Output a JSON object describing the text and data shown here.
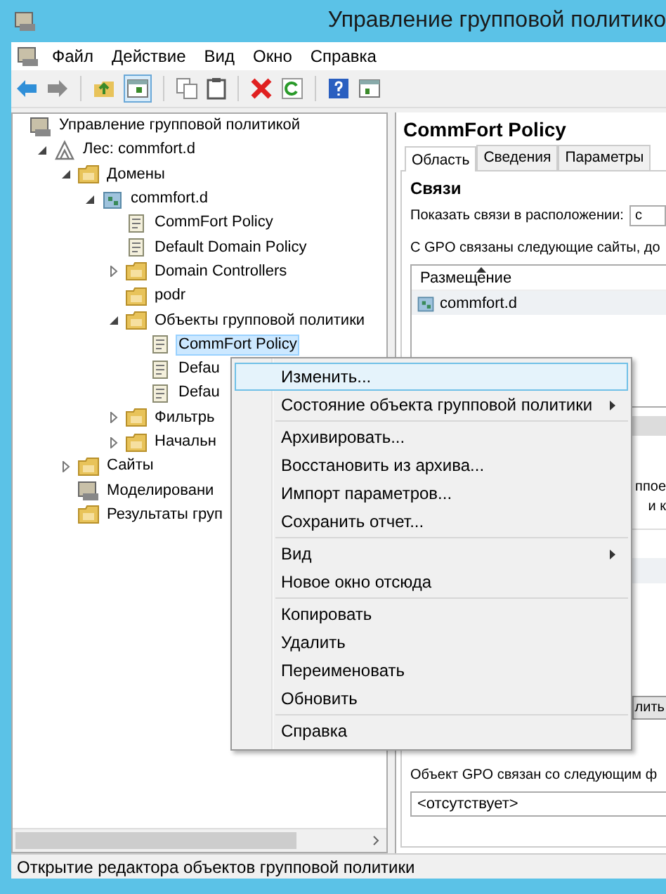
{
  "window": {
    "title": "Управление групповой политико"
  },
  "menu_bar": [
    "Файл",
    "Действие",
    "Вид",
    "Окно",
    "Справка"
  ],
  "tree": [
    {
      "label": "Управление групповой политикой",
      "kind": "console",
      "children": [
        {
          "label": "Лес: commfort.d",
          "kind": "forest",
          "expanded": true,
          "children": [
            {
              "label": "Домены",
              "kind": "domains",
              "expanded": true,
              "children": [
                {
                  "label": "commfort.d",
                  "kind": "domain",
                  "expanded": true,
                  "children": [
                    {
                      "label": "CommFort Policy",
                      "kind": "link",
                      "selected": false
                    },
                    {
                      "label": "Default Domain Policy",
                      "kind": "link",
                      "selected": false
                    },
                    {
                      "label": "Domain Controllers",
                      "kind": "folder",
                      "expanded": false,
                      "selected": false
                    },
                    {
                      "label": "podr",
                      "kind": "folder",
                      "selected": false
                    },
                    {
                      "label": "Объекты групповой политики",
                      "kind": "gpo-folder",
                      "expanded": true,
                      "selected": false,
                      "children": [
                        {
                          "label": "CommFort Policy",
                          "kind": "gpo",
                          "selected": true
                        },
                        {
                          "label": "Defau",
                          "kind": "gpo",
                          "selected": false
                        },
                        {
                          "label": "Defau",
                          "kind": "gpo",
                          "selected": false
                        }
                      ]
                    },
                    {
                      "label": "Фильтрь",
                      "kind": "gpo-folder",
                      "expanded": false,
                      "selected": false
                    },
                    {
                      "label": "Начальн",
                      "kind": "starter",
                      "expanded": false,
                      "selected": false
                    }
                  ]
                }
              ]
            },
            {
              "label": "Сайты",
              "kind": "sites",
              "expanded": false,
              "selected": false
            },
            {
              "label": "Моделировани",
              "kind": "modeling",
              "selected": false
            },
            {
              "label": "Результаты груп",
              "kind": "results",
              "selected": false
            }
          ]
        }
      ]
    }
  ],
  "details": {
    "title": "CommFort Policy",
    "tabs": [
      {
        "label": "Область",
        "selected": true
      },
      {
        "label": "Сведения",
        "selected": false
      },
      {
        "label": "Параметры",
        "selected": false
      }
    ],
    "section": "Связи",
    "location_label": "Показать связи в расположении:",
    "location_value": "c",
    "links_caption": "С GPO связаны следующие сайты, до",
    "links_table": {
      "columns": [
        "Размещение"
      ],
      "rows": [
        "commfort.d"
      ]
    },
    "fragments": [
      "ппое",
      "и к"
    ],
    "button_fragment": "лить",
    "wmi_caption": "Объект GPO связан со следующим ф",
    "wmi_value": "<отсутствует>"
  },
  "context_menu": [
    [
      {
        "label": "Изменить...",
        "submenu": false,
        "selected": true
      },
      {
        "label": "Состояние объекта групповой политики",
        "submenu": true,
        "selected": false
      }
    ],
    [
      {
        "label": "Архивировать...",
        "submenu": false,
        "selected": false
      },
      {
        "label": "Восстановить из архива...",
        "submenu": false,
        "selected": false
      },
      {
        "label": "Импорт параметров...",
        "submenu": false,
        "selected": false
      },
      {
        "label": "Сохранить отчет...",
        "submenu": false,
        "selected": false
      }
    ],
    [
      {
        "label": "Вид",
        "submenu": true,
        "selected": false
      },
      {
        "label": "Новое окно отсюда",
        "submenu": false,
        "selected": false
      }
    ],
    [
      {
        "label": "Копировать",
        "submenu": false,
        "selected": false
      },
      {
        "label": "Удалить",
        "submenu": false,
        "selected": false
      },
      {
        "label": "Переименовать",
        "submenu": false,
        "selected": false
      },
      {
        "label": "Обновить",
        "submenu": false,
        "selected": false
      }
    ],
    [
      {
        "label": "Справка",
        "submenu": false,
        "selected": false
      }
    ]
  ],
  "status_bar": "Открытие редактора объектов групповой политики"
}
